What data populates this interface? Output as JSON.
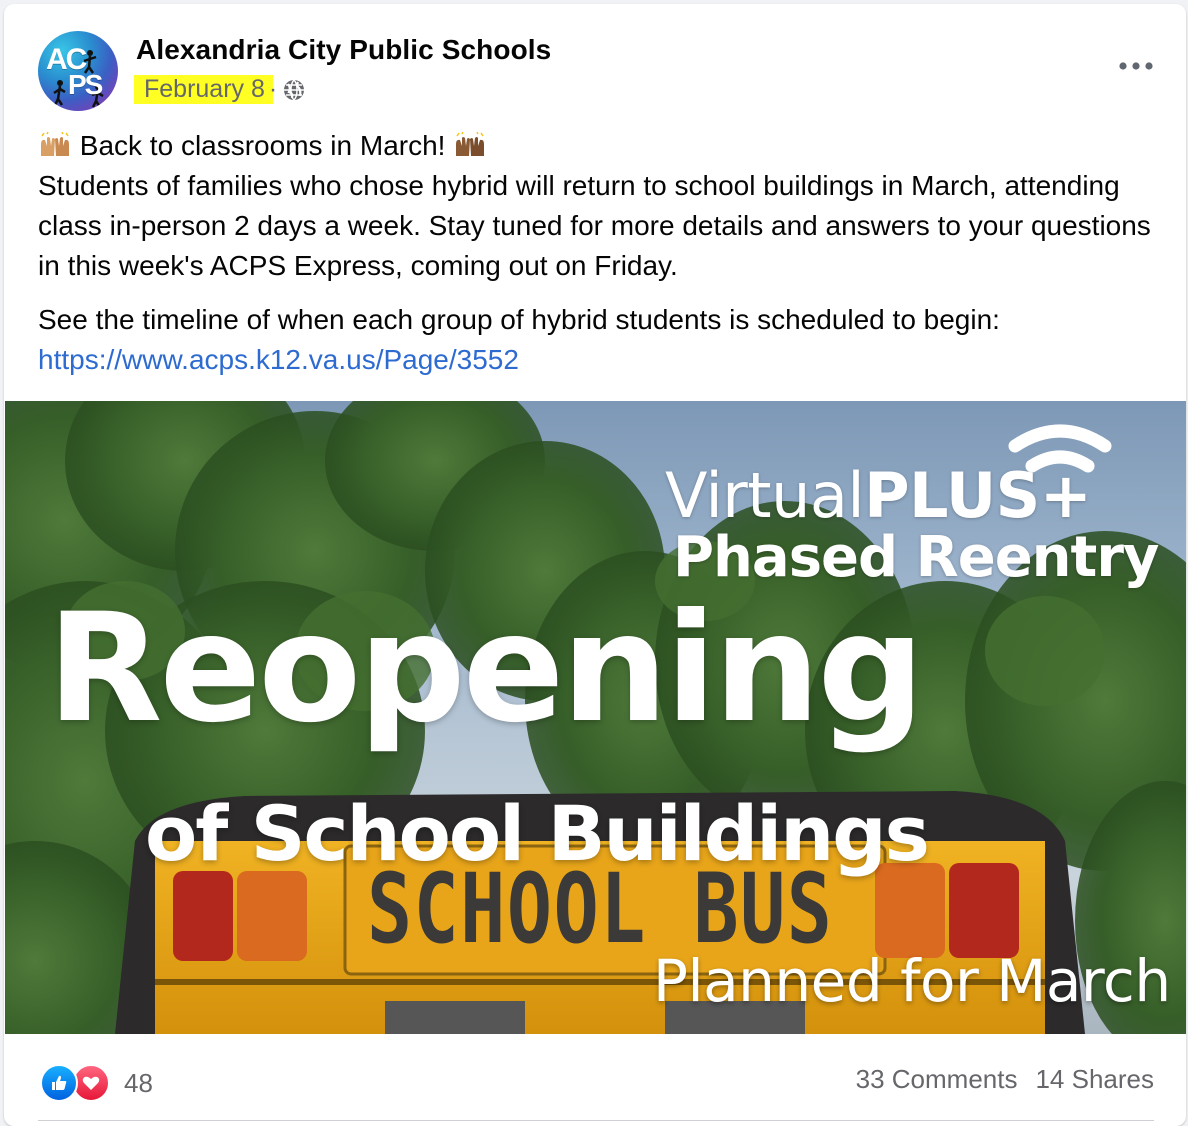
{
  "post": {
    "page_name": "Alexandria City Public Schools",
    "avatar_text_top": "AC",
    "avatar_text_bottom": "PS",
    "date": "February 8",
    "separator": "·",
    "privacy_icon": "globe-icon",
    "more_icon": "more-horizontal-icon",
    "text_line1": "Back to classrooms in March!",
    "text_body": "Students of families who chose hybrid will return to school buildings in March, attending class in-person 2 days a week. Stay tuned for more details and answers to your questions in this week's ACPS Express, coming out on Friday.",
    "timeline_text": "See the timeline of when each group of hybrid students is scheduled to begin:",
    "link": "https://www.acps.k12.va.us/Page/3552",
    "emoji_icon": "raising-hands-icon"
  },
  "image": {
    "virtual_plain": "Virtual",
    "virtual_bold": "PLUS+",
    "phased": "Phased Reentry",
    "reopening": "Reopening",
    "of_school": "of School Buildings",
    "bus_sign": "SCHOOL BUS",
    "planned": "Planned for March"
  },
  "footer": {
    "reaction_count": "48",
    "comments": "33 Comments",
    "shares": "14 Shares",
    "like_icon": "like-icon",
    "love_icon": "love-icon"
  },
  "colors": {
    "link": "#2d6bd1",
    "highlight": "#ffff24",
    "like": "#0062df",
    "love": "#e61739",
    "bus_yellow": "#e9a514"
  }
}
